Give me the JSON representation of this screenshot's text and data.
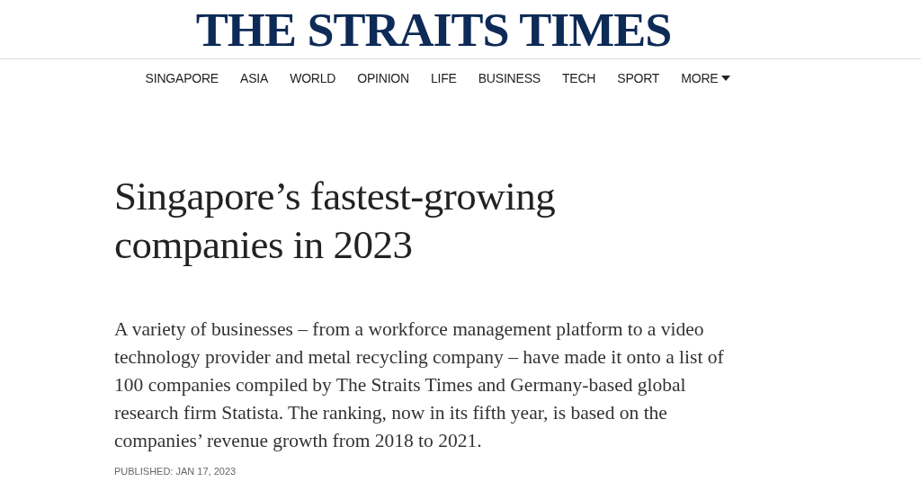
{
  "masthead": {
    "logo": "THE STRAITS TIMES"
  },
  "nav": {
    "items": [
      {
        "label": "SINGAPORE"
      },
      {
        "label": "ASIA"
      },
      {
        "label": "WORLD"
      },
      {
        "label": "OPINION"
      },
      {
        "label": "LIFE"
      },
      {
        "label": "BUSINESS"
      },
      {
        "label": "TECH"
      },
      {
        "label": "SPORT"
      },
      {
        "label": "MORE",
        "dropdown": true
      }
    ]
  },
  "article": {
    "headline": "Singapore’s fastest-growing companies in 2023",
    "standfirst": "A variety of businesses – from a workforce management platform to a video technology provider and metal recycling company – have made it onto a list of 100 companies compiled by The Straits Times and Germany-based global research firm Statista. The ranking, now in its fifth year, is based on the companies’ revenue growth from 2018 to 2021.",
    "published": "PUBLISHED: JAN 17, 2023"
  }
}
